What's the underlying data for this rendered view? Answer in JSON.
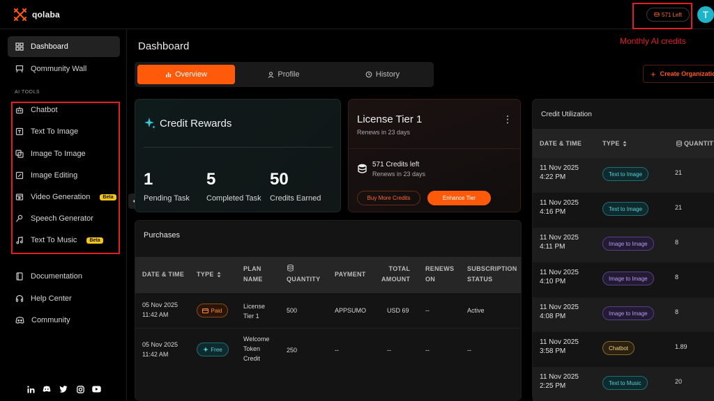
{
  "brand": {
    "name": "qolaba"
  },
  "header": {
    "credits_left": "571 Left",
    "avatar_initial": "T",
    "annotation": "Monthly AI credits"
  },
  "sidebar": {
    "top_items": [
      {
        "label": "Dashboard",
        "icon": "grid-icon",
        "active": true
      },
      {
        "label": "Qommunity Wall",
        "icon": "board-icon"
      }
    ],
    "section_label": "AI TOOLS",
    "tools": [
      {
        "label": "Chatbot",
        "icon": "bot-icon"
      },
      {
        "label": "Text To Image",
        "icon": "text-image-icon"
      },
      {
        "label": "Image To Image",
        "icon": "image-image-icon"
      },
      {
        "label": "Image Editing",
        "icon": "edit-icon"
      },
      {
        "label": "Video Generation",
        "icon": "video-icon",
        "badge": "Beta"
      },
      {
        "label": "Speech Generator",
        "icon": "mic-icon"
      },
      {
        "label": "Text To Music",
        "icon": "music-icon",
        "badge": "Beta"
      }
    ],
    "bottom_items": [
      {
        "label": "Documentation",
        "icon": "doc-icon"
      },
      {
        "label": "Help Center",
        "icon": "headset-icon"
      },
      {
        "label": "Community",
        "icon": "discord-icon"
      }
    ]
  },
  "main": {
    "title": "Dashboard",
    "tabs": [
      {
        "label": "Overview",
        "active": true
      },
      {
        "label": "Profile"
      },
      {
        "label": "History"
      }
    ],
    "create_org_label": "Create Organization"
  },
  "rewards": {
    "title": "Credit Rewards",
    "stats": [
      {
        "value": "1",
        "label": "Pending Task"
      },
      {
        "value": "5",
        "label": "Completed Task"
      },
      {
        "value": "50",
        "label": "Credits Earned"
      }
    ]
  },
  "license": {
    "title": "License Tier 1",
    "renews": "Renews in 23 days",
    "credits_left": "571 Credits left",
    "credits_renew": "Renews in 23 days",
    "buy_label": "Buy More Credits",
    "enhance_label": "Enhance Tier"
  },
  "purchases": {
    "title": "Purchases",
    "headers": {
      "date": [
        "DATE & TIME"
      ],
      "type": [
        "TYPE"
      ],
      "plan": [
        "PLAN",
        "NAME"
      ],
      "quantity": [
        "QUANTITY"
      ],
      "payment": [
        "PAYMENT"
      ],
      "total": [
        "TOTAL",
        "AMOUNT"
      ],
      "renews": [
        "RENEWS",
        "ON"
      ],
      "status": [
        "SUBSCRIPTION",
        "STATUS"
      ]
    },
    "rows": [
      {
        "date": "05 Nov 2025",
        "time": "11:42 AM",
        "type": "Paid",
        "plan": [
          "License",
          "Tier 1"
        ],
        "quantity": "500",
        "payment": "APPSUMO",
        "total": "USD 69",
        "renews": "--",
        "status": "Active"
      },
      {
        "date": "05 Nov 2025",
        "time": "11:42 AM",
        "type": "Free",
        "plan": [
          "Welcome",
          "Token",
          "Credit"
        ],
        "quantity": "250",
        "payment": "--",
        "total": "--",
        "renews": "--",
        "status": "--"
      }
    ]
  },
  "utilization": {
    "title": "Credit Utilization",
    "headers": {
      "date": "DATE & TIME",
      "type": "TYPE",
      "quantity": "QUANTITY"
    },
    "rows": [
      {
        "date": "11 Nov 2025",
        "time": "4:22 PM",
        "type": "Text to Image",
        "kind": "t2i",
        "quantity": "21"
      },
      {
        "date": "11 Nov 2025",
        "time": "4:16 PM",
        "type": "Text to Image",
        "kind": "t2i",
        "quantity": "21"
      },
      {
        "date": "11 Nov 2025",
        "time": "4:11 PM",
        "type": "Image to Image",
        "kind": "i2i",
        "quantity": "8"
      },
      {
        "date": "11 Nov 2025",
        "time": "4:10 PM",
        "type": "Image to Image",
        "kind": "i2i",
        "quantity": "8"
      },
      {
        "date": "11 Nov 2025",
        "time": "4:08 PM",
        "type": "Image to Image",
        "kind": "i2i",
        "quantity": "8"
      },
      {
        "date": "11 Nov 2025",
        "time": "3:58 PM",
        "type": "Chatbot",
        "kind": "chat",
        "quantity": "1.89"
      },
      {
        "date": "11 Nov 2025",
        "time": "2:25 PM",
        "type": "Text to Music",
        "kind": "t2i",
        "quantity": "20"
      }
    ]
  },
  "colors": {
    "accent": "#ff5a0a",
    "highlight": "#e02020"
  }
}
